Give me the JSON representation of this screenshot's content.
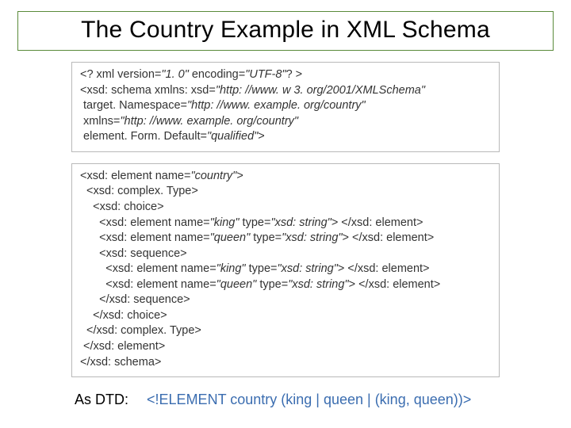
{
  "title": "The Country Example in XML Schema",
  "prolog": {
    "l1a": "<? xml version=",
    "l1b": "\"1. 0\"",
    "l1c": " encoding=",
    "l1d": "\"UTF-8\"",
    "l1e": "? >",
    "l2a": "<xsd: schema xmlns: xsd=",
    "l2b": "\"http: //www. w 3. org/2001/XMLSchema\"",
    "l3a": " target. Namespace=",
    "l3b": "\"http: //www. example. org/country\"",
    "l4a": " xmlns=",
    "l4b": "\"http: //www. example. org/country\"",
    "l5a": " element. Form. Default=",
    "l5b": "\"qualified\"",
    "l5c": ">"
  },
  "body": {
    "l1a": "<xsd: element name=",
    "l1b": "\"country\"",
    "l1c": ">",
    "l2": "  <xsd: complex. Type>",
    "l3": "    <xsd: choice>",
    "l4a": "      <xsd: element name=",
    "l4b": "\"king\"",
    "l4c": " type=",
    "l4d": "\"xsd: string\"",
    "l4e": "> </xsd: element>",
    "l5a": "      <xsd: element name=",
    "l5b": "\"queen\"",
    "l5c": " type=",
    "l5d": "\"xsd: string\"",
    "l5e": "> </xsd: element>",
    "l6": "      <xsd: sequence>",
    "l7a": "        <xsd: element name=",
    "l7b": "\"king\"",
    "l7c": " type=",
    "l7d": "\"xsd: string\"",
    "l7e": "> </xsd: element>",
    "l8a": "        <xsd: element name=",
    "l8b": "\"queen\"",
    "l8c": " type=",
    "l8d": "\"xsd: string\"",
    "l8e": "> </xsd: element>",
    "l9": "      </xsd: sequence>",
    "l10": "    </xsd: choice>",
    "l11": "  </xsd: complex. Type>",
    "l12": " </xsd: element>",
    "l13": "</xsd: schema>"
  },
  "dtd": {
    "label": "As DTD:",
    "code": "<!ELEMENT country (king | queen | (king, queen))>"
  }
}
